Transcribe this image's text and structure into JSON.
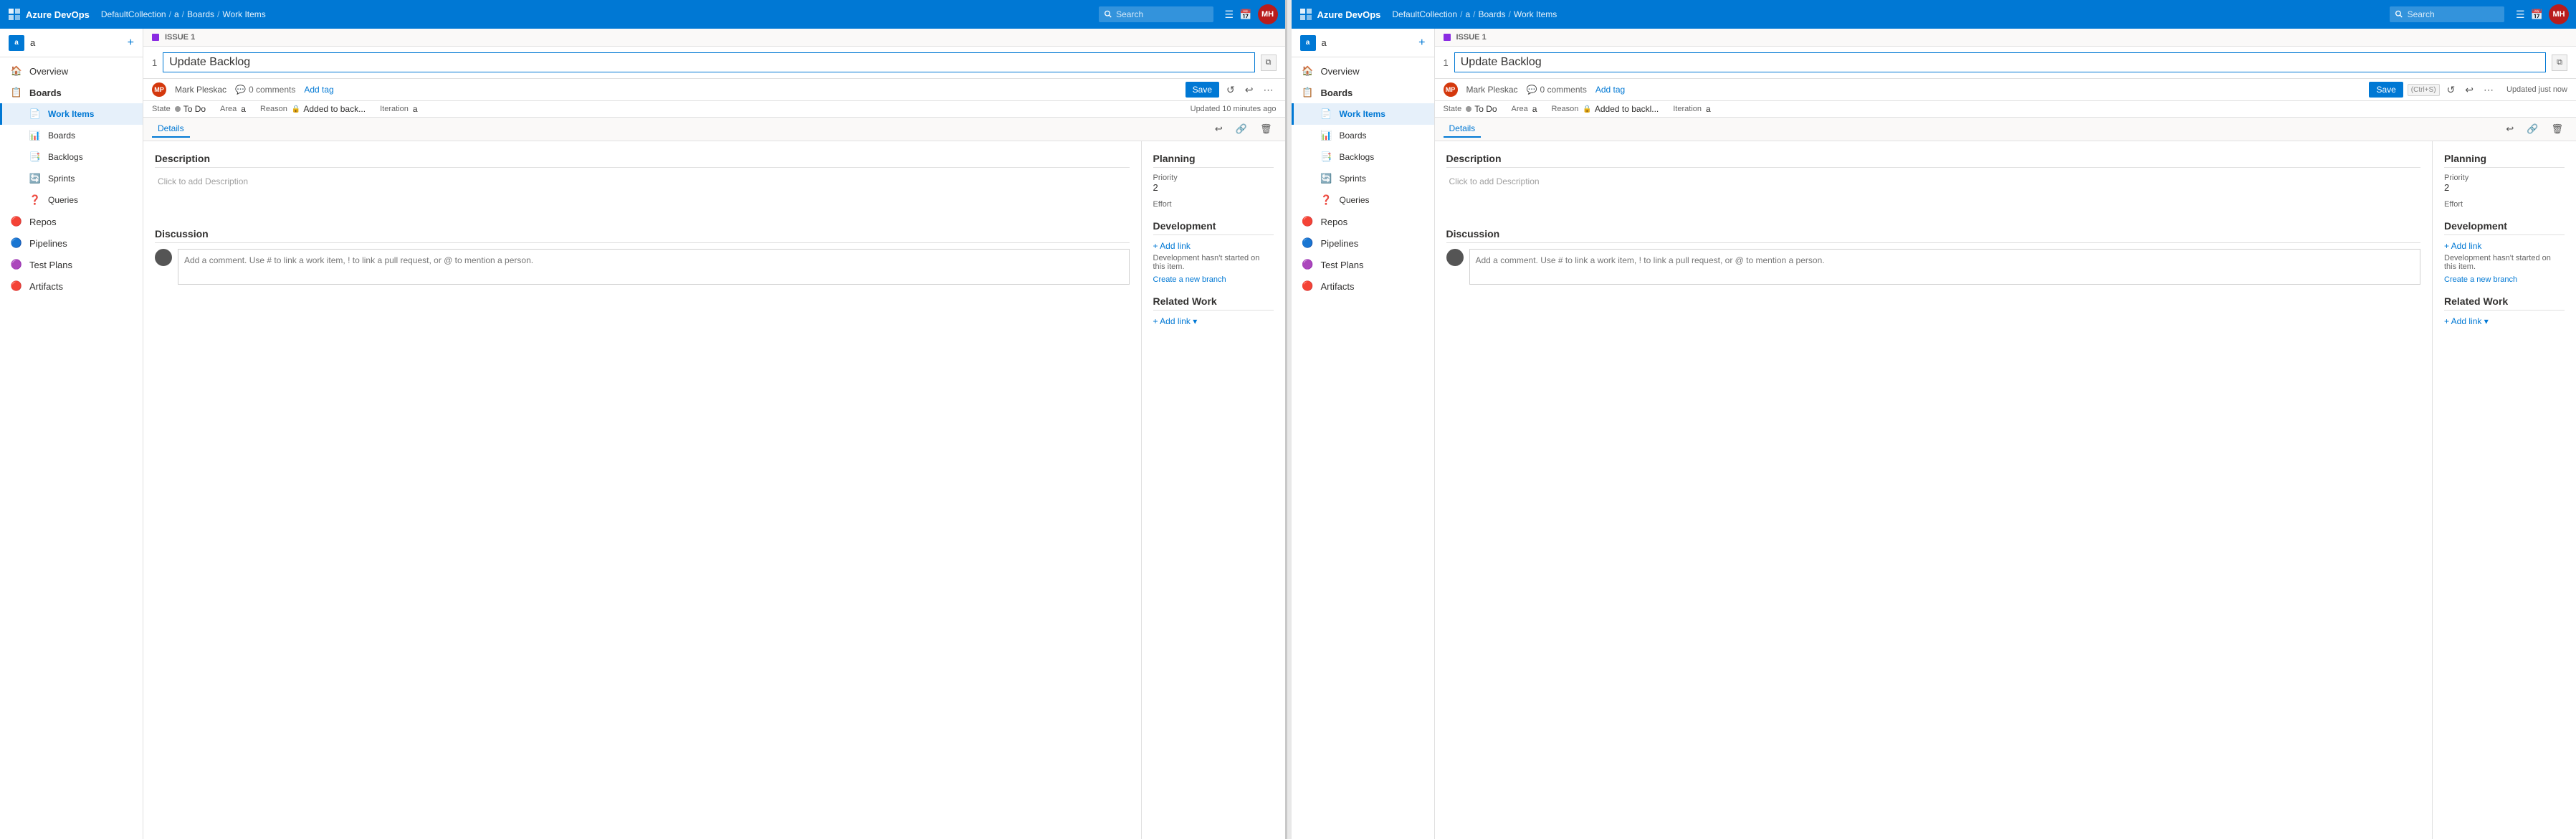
{
  "app": {
    "name": "Azure DevOps",
    "logo_color": "#0078d4"
  },
  "left_panel": {
    "topbar": {
      "breadcrumb": [
        "DefaultCollection",
        "a",
        "Boards",
        "Work Items"
      ],
      "search_placeholder": "Search",
      "icons": [
        "list-icon",
        "calendar-icon"
      ],
      "avatar_initials": "MH"
    },
    "sidebar": {
      "project_name": "a",
      "project_initial": "a",
      "nav_items": [
        {
          "id": "overview",
          "label": "Overview",
          "icon": "🏠"
        },
        {
          "id": "boards",
          "label": "Boards",
          "icon": "📋",
          "active_parent": true
        },
        {
          "id": "work-items",
          "label": "Work Items",
          "icon": "📄",
          "active": true
        },
        {
          "id": "boards-sub",
          "label": "Boards",
          "icon": "📊",
          "sub": true
        },
        {
          "id": "backlogs",
          "label": "Backlogs",
          "icon": "📑",
          "sub": true
        },
        {
          "id": "sprints",
          "label": "Sprints",
          "icon": "🔄",
          "sub": true
        },
        {
          "id": "queries",
          "label": "Queries",
          "icon": "❓",
          "sub": true
        },
        {
          "id": "repos",
          "label": "Repos",
          "icon": "🔴"
        },
        {
          "id": "pipelines",
          "label": "Pipelines",
          "icon": "🔵"
        },
        {
          "id": "test-plans",
          "label": "Test Plans",
          "icon": "🟣"
        },
        {
          "id": "artifacts",
          "label": "Artifacts",
          "icon": "🔴"
        }
      ]
    },
    "workitem": {
      "issue_label": "ISSUE 1",
      "number": "1",
      "title": "Update Backlog",
      "author": "Mark Pleskac",
      "comments": "0 comments",
      "add_tag": "Add tag",
      "save_label": "Save",
      "state_label": "State",
      "state_value": "To Do",
      "area_label": "Area",
      "area_value": "a",
      "reason_label": "Reason",
      "reason_value": "Added to back...",
      "iteration_label": "Iteration",
      "iteration_value": "a",
      "updated_text": "Updated 10 minutes ago",
      "details_tab": "Details",
      "description_section": "Description",
      "description_placeholder": "Click to add Description",
      "discussion_section": "Discussion",
      "comment_placeholder": "Add a comment. Use # to link a work item, ! to link a pull request, or @ to mention a person.",
      "planning_section": "Planning",
      "priority_label": "Priority",
      "priority_value": "2",
      "effort_label": "Effort",
      "effort_value": "",
      "development_section": "Development",
      "add_link_label": "+ Add link",
      "dev_hint": "Development hasn't started on this item.",
      "create_branch_label": "Create a new branch",
      "related_work_section": "Related Work",
      "related_add_label": "+ Add link"
    }
  },
  "right_panel": {
    "topbar": {
      "breadcrumb": [
        "DefaultCollection",
        "a",
        "Boards",
        "Work Items"
      ],
      "search_placeholder": "Search",
      "icons": [
        "list-icon",
        "calendar-icon"
      ],
      "avatar_initials": "MH"
    },
    "sidebar": {
      "project_name": "a",
      "project_initial": "a",
      "nav_items": [
        {
          "id": "overview",
          "label": "Overview",
          "icon": "🏠"
        },
        {
          "id": "boards",
          "label": "Boards",
          "icon": "📋",
          "active_parent": true
        },
        {
          "id": "work-items",
          "label": "Work Items",
          "icon": "📄",
          "active": true
        },
        {
          "id": "boards-sub",
          "label": "Boards",
          "icon": "📊",
          "sub": true
        },
        {
          "id": "backlogs",
          "label": "Backlogs",
          "icon": "📑",
          "sub": true
        },
        {
          "id": "sprints",
          "label": "Sprints",
          "icon": "🔄",
          "sub": true
        },
        {
          "id": "queries",
          "label": "Queries",
          "icon": "❓",
          "sub": true
        },
        {
          "id": "repos",
          "label": "Repos",
          "icon": "🔴"
        },
        {
          "id": "pipelines",
          "label": "Pipelines",
          "icon": "🔵"
        },
        {
          "id": "test-plans",
          "label": "Test Plans",
          "icon": "🟣"
        },
        {
          "id": "artifacts",
          "label": "Artifacts",
          "icon": "🔴"
        }
      ]
    },
    "workitem": {
      "issue_label": "ISSUE 1",
      "number": "1",
      "title": "Update Backlog",
      "author": "Mark Pleskac",
      "comments": "0 comments",
      "add_tag": "Add tag",
      "save_label": "Save",
      "ctrl_s": "(Ctrl+S)",
      "updated_text": "Updated just now",
      "state_label": "State",
      "state_value": "To Do",
      "area_label": "Area",
      "area_value": "a",
      "reason_label": "Reason",
      "reason_value": "Added to backl...",
      "iteration_label": "Iteration",
      "iteration_value": "a",
      "details_tab": "Details",
      "description_section": "Description",
      "description_placeholder": "Click to add Description",
      "discussion_section": "Discussion",
      "comment_placeholder": "Add a comment. Use # to link a work item, ! to link a pull request, or @ to mention a person.",
      "planning_section": "Planning",
      "priority_label": "Priority",
      "priority_value": "2",
      "effort_label": "Effort",
      "effort_value": "",
      "development_section": "Development",
      "add_link_label": "+ Add link",
      "dev_hint": "Development hasn't started on this item.",
      "create_branch_label": "Create a new branch",
      "related_work_section": "Related Work",
      "related_add_label": "+ Add link"
    }
  }
}
